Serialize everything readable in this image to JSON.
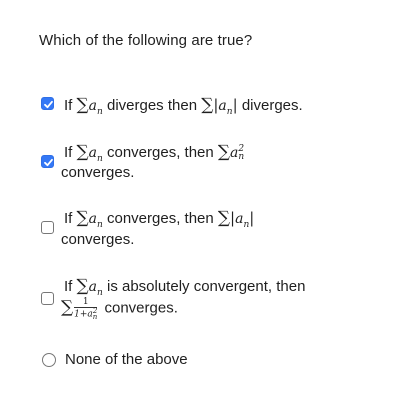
{
  "question": "Which of the following are true?",
  "options": [
    {
      "checked": true,
      "type": "checkbox",
      "pre": "If",
      "mid": "diverges then",
      "post": "diverges."
    },
    {
      "checked": true,
      "type": "checkbox",
      "pre": "If",
      "mid": "converges, then",
      "post": "converges."
    },
    {
      "checked": false,
      "type": "checkbox",
      "pre": "If",
      "mid": "converges, then",
      "post": "converges."
    },
    {
      "checked": false,
      "type": "checkbox",
      "pre": "If",
      "mid": "is absolutely convergent, then",
      "post": "converges."
    },
    {
      "checked": false,
      "type": "radio",
      "label": "None of the above"
    }
  ],
  "math": {
    "sigma": "∑",
    "a": "a",
    "n": "n",
    "two": "2",
    "bar": "|",
    "one": "1",
    "den_prefix": "1+"
  },
  "colors": {
    "accent": "#3478f6",
    "text": "#1f1f1f"
  },
  "icons": {
    "checked": "checkmark-icon"
  }
}
